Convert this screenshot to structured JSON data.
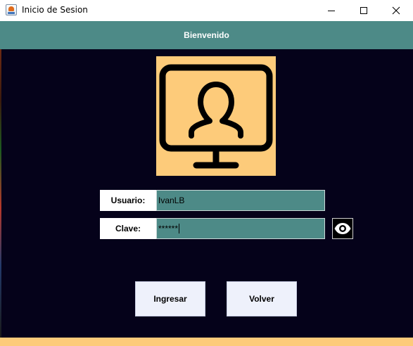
{
  "window": {
    "title": "Inicio de Sesion",
    "icon": "java-app-icon",
    "controls": [
      "minimize-icon",
      "maximize-icon",
      "close-icon"
    ]
  },
  "header": {
    "title": "Bienvenido"
  },
  "logo": {
    "icon": "user-monitor-icon",
    "background": "#fdcb7a"
  },
  "form": {
    "usuario": {
      "label": "Usuario:",
      "value": "IvanLB"
    },
    "clave": {
      "label": "Clave:",
      "value": "******",
      "toggle_icon": "eye-icon"
    }
  },
  "buttons": {
    "ingresar": "Ingresar",
    "volver": "Volver"
  },
  "colors": {
    "header": "#4d8a87",
    "background": "#05021a",
    "accent": "#fdcb7a",
    "field": "#4d8a87",
    "button": "#eef1fb"
  }
}
